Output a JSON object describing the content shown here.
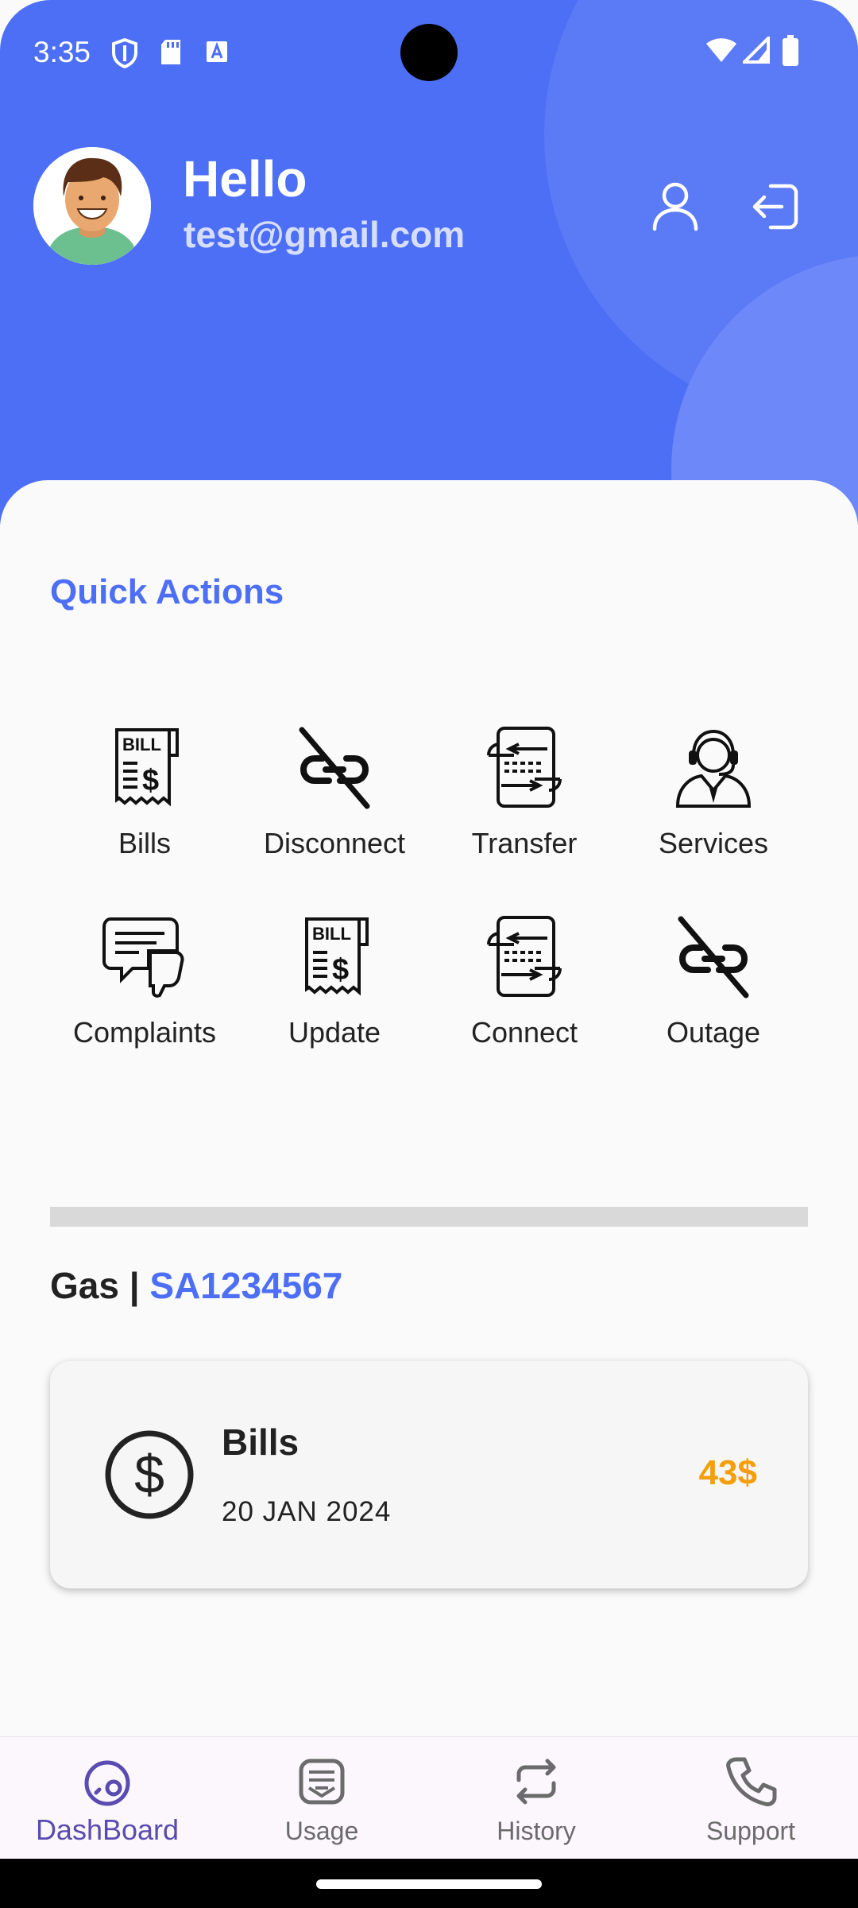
{
  "status_bar": {
    "time": "3:35"
  },
  "header": {
    "greeting": "Hello",
    "email": "test@gmail.com"
  },
  "quick_actions": {
    "title": "Quick Actions",
    "items": [
      {
        "label": "Bills",
        "icon": "bill-receipt-icon"
      },
      {
        "label": "Disconnect",
        "icon": "broken-link-icon"
      },
      {
        "label": "Transfer",
        "icon": "transfer-document-icon"
      },
      {
        "label": "Services",
        "icon": "support-agent-icon"
      },
      {
        "label": "Complaints",
        "icon": "complaint-thumbs-down-icon"
      },
      {
        "label": "Update",
        "icon": "bill-receipt-icon"
      },
      {
        "label": "Connect",
        "icon": "transfer-document-icon"
      },
      {
        "label": "Outage",
        "icon": "broken-link-icon"
      }
    ]
  },
  "account": {
    "type": "Gas",
    "separator": " | ",
    "number": "SA1234567"
  },
  "bill_card": {
    "title": "Bills",
    "date": "20 JAN 2024",
    "amount": "43$",
    "amount_color": "#f59e0b"
  },
  "bottom_nav": {
    "items": [
      {
        "label": "DashBoard",
        "icon": "dashboard-icon",
        "active": true
      },
      {
        "label": "Usage",
        "icon": "usage-message-icon",
        "active": false
      },
      {
        "label": "History",
        "icon": "history-repeat-icon",
        "active": false
      },
      {
        "label": "Support",
        "icon": "phone-icon",
        "active": false
      }
    ]
  },
  "colors": {
    "primary": "#4d6ff5",
    "accent_amount": "#f59e0b",
    "nav_active": "#5a4bb0"
  }
}
